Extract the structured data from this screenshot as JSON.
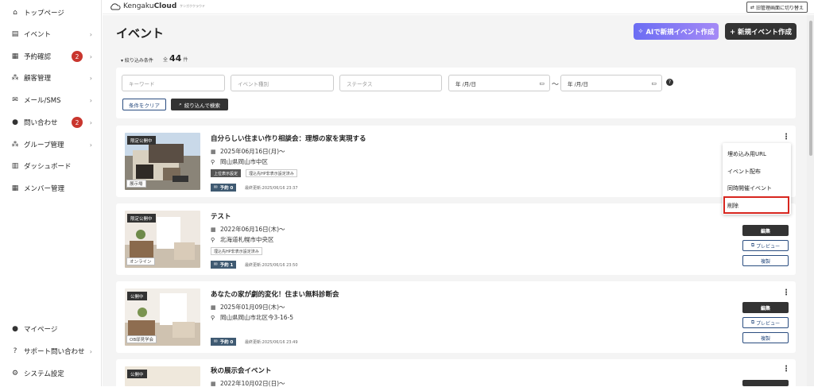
{
  "sidebar": {
    "items": [
      {
        "label": "トップページ",
        "icon": "home-icon",
        "glyph": "⌂",
        "badge": "",
        "chevron": ""
      },
      {
        "label": "イベント",
        "icon": "document-icon",
        "glyph": "▤",
        "badge": "",
        "chevron": "›"
      },
      {
        "label": "予約確認",
        "icon": "calendar-icon",
        "glyph": "▦",
        "badge": "2",
        "chevron": "›"
      },
      {
        "label": "顧客管理",
        "icon": "users-icon",
        "glyph": "⁂",
        "badge": "",
        "chevron": "›"
      },
      {
        "label": "メール/SMS",
        "icon": "mail-icon",
        "glyph": "✉",
        "badge": "",
        "chevron": "›"
      },
      {
        "label": "問い合わせ",
        "icon": "chat-icon",
        "glyph": "●",
        "badge": "2",
        "chevron": "›"
      },
      {
        "label": "グループ管理",
        "icon": "group-icon",
        "glyph": "⁂",
        "badge": "",
        "chevron": "›"
      },
      {
        "label": "ダッシュボード",
        "icon": "chart-icon",
        "glyph": "▥",
        "badge": "",
        "chevron": ""
      },
      {
        "label": "メンバー管理",
        "icon": "grid-icon",
        "glyph": "▦",
        "badge": "",
        "chevron": ""
      }
    ],
    "bottom": [
      {
        "label": "マイページ",
        "icon": "person-icon",
        "glyph": "●",
        "chevron": ""
      },
      {
        "label": "サポート問い合わせ",
        "icon": "help-icon",
        "glyph": "?",
        "chevron": "›"
      },
      {
        "label": "システム設定",
        "icon": "gear-icon",
        "glyph": "⚙",
        "chevron": ""
      }
    ]
  },
  "header": {
    "logo_text": "Kengaku",
    "logo_bold": "Cloud",
    "logo_sub": "ケンガククラウド",
    "old_admin_label": "旧管理画面に切り替え"
  },
  "page": {
    "title": "イベント",
    "ai_button": "AIで新規イベント作成",
    "new_button": "+ 新規イベント作成",
    "filter_toggle": "▾ 絞り込み条件",
    "total_prefix": "全",
    "total_count": "44",
    "total_suffix": "件"
  },
  "filters": {
    "keyword_placeholder": "キーワード",
    "type_placeholder": "イベント種別",
    "status_placeholder": "ステータス",
    "date_from": "年 /月/日",
    "date_to": "年 /月/日",
    "tilde": "〜",
    "clear_label": "条件をクリア",
    "search_label": "絞り込んで検索"
  },
  "events": [
    {
      "title": "自分らしい住まい作り相談会：理想の家を実現する",
      "date": "2025年06月16日(月)〜",
      "place": "岡山県岡山市中区",
      "chips": [
        "上位表示設定",
        "埋込先HP非表示設定済み"
      ],
      "status": "限定公開中",
      "venue": "展示場",
      "reservations": "予約 0",
      "updated": "最終更新:2025/06/16 23:37"
    },
    {
      "title": "テスト",
      "date": "2022年06月16日(木)〜",
      "place": "北海道札幌市中央区",
      "chips": [
        "埋込先HP非表示設定済み"
      ],
      "status": "限定公開中",
      "venue": "オンライン",
      "reservations": "予約 1",
      "updated": "最終更新:2025/06/16 23:50"
    },
    {
      "title": "あなたの家が劇的変化！住まい無料診断会",
      "date": "2025年01月09日(木)〜",
      "place": "岡山県岡山市北区今3-16-5",
      "chips": [],
      "status": "公開中",
      "venue": "OB邸見学会",
      "reservations": "予約 0",
      "updated": "最終更新:2025/06/16 23:49"
    },
    {
      "title": "秋の展示会イベント",
      "date": "2022年10月02日(日)〜",
      "place": "",
      "chips": [],
      "status": "公開中",
      "venue": "",
      "reservations": "",
      "updated": ""
    }
  ],
  "actions": {
    "edit": "編集",
    "preview": "プレビュー",
    "copy": "複製"
  },
  "context_menu": {
    "items": [
      "埋め込み用URL",
      "イベント配布",
      "同時開催イベント",
      "削除"
    ]
  },
  "colors": {
    "accent": "#2a4d80",
    "badge": "#c9362e",
    "highlight": "#d7261f",
    "ai_gradient_start": "#6b6df3",
    "ai_gradient_end": "#a58af6"
  }
}
